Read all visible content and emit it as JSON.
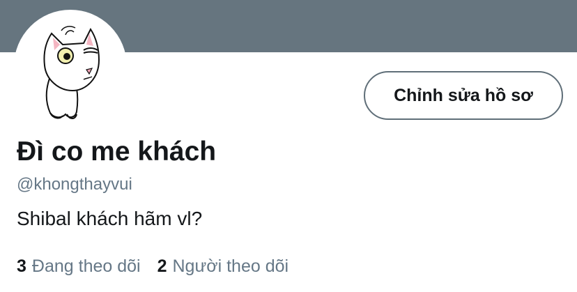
{
  "profile": {
    "display_name": "Đì co me khách",
    "handle": "@khongthayvui",
    "bio": "Shibal khách hãm vl?",
    "edit_button_label": "Chỉnh sửa hồ sơ",
    "banner_color": "#66757f"
  },
  "stats": {
    "following": {
      "count": "3",
      "label": "Đang theo dõi"
    },
    "followers": {
      "count": "2",
      "label": "Người theo dõi"
    }
  },
  "avatar": {
    "icon": "cartoon-cat-avatar"
  }
}
